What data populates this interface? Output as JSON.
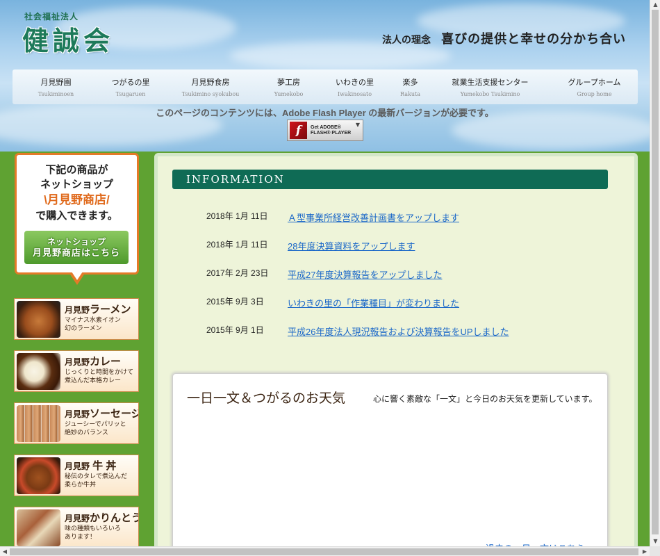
{
  "header": {
    "org_type": "社会福祉法人",
    "logo": "健誠会",
    "philosophy_label": "法人の理念",
    "philosophy_text": "喜びの提供と幸せの分かち合い"
  },
  "nav": {
    "items": [
      {
        "jp": "月見野園",
        "en": "Tsukiminoen"
      },
      {
        "jp": "つがるの里",
        "en": "Tsugaruen"
      },
      {
        "jp": "月見野食房",
        "en": "Tsukimino syokubou"
      },
      {
        "jp": "夢工房",
        "en": "Yumekobo"
      },
      {
        "jp": "いわきの里",
        "en": "Iwakinosato"
      },
      {
        "jp": "楽多",
        "en": "Rakuta"
      },
      {
        "jp": "就業生活支援センター",
        "en": "Yumekobo Tsukimino"
      },
      {
        "jp": "グループホーム",
        "en": "Group home"
      }
    ]
  },
  "flash": {
    "message": "このページのコンテンツには、Adobe Flash Player の最新バージョンが必要です。",
    "badge_line1": "Get ADOBE®",
    "badge_line2": "FLASH® PLAYER"
  },
  "sidebar": {
    "promo_line1": "下記の商品が",
    "promo_line2": "ネットショップ",
    "promo_shop": "\\月見野商店/",
    "promo_line3": "で購入できます。",
    "promo_button_line1": "ネットショップ",
    "promo_button_line2": "月見野商店はこちら",
    "products": [
      {
        "pre": "月見野",
        "main": "ラーメン",
        "desc": "マイナス水素イオン\n幻のラーメン"
      },
      {
        "pre": "月見野",
        "main": "カレー",
        "desc": "じっくりと時間をかけて\n煮込んだ本格カレー"
      },
      {
        "pre": "月見野",
        "main": "ソーセージ",
        "desc": "ジューシーでパリッと\n絶妙のバランス"
      },
      {
        "pre": "月見野",
        "main": " 牛 丼",
        "desc": "秘伝のタレで煮込んだ\n柔らか牛丼"
      },
      {
        "pre": "月見野",
        "main": "かりんとう",
        "desc": "味の種類もいろいろ\nあります！"
      }
    ]
  },
  "main": {
    "info_title": "INFORMATION",
    "news": [
      {
        "date": "2018年 1月 11日",
        "title": "Ａ型事業所経営改善計画書をアップします"
      },
      {
        "date": "2018年 1月 11日",
        "title": "28年度決算資料をアップします"
      },
      {
        "date": "2017年 2月 23日",
        "title": "平成27年度決算報告をアップしました"
      },
      {
        "date": "2015年 9月 3日",
        "title": "いわきの里の「作業種目」が変わりました"
      },
      {
        "date": "2015年 9月 1日",
        "title": "平成26年度法人現況報告および決算報告をUPしました"
      }
    ],
    "weather_title": "一日一文＆つがるのお天気",
    "weather_desc": "心に響く素敵な「一文」と今日のお天気を更新しています。",
    "weather_link": "過去の一日一文はこちら"
  },
  "colors": {
    "sidebar_green": "#5fa232",
    "info_bar": "#0f6b55",
    "promo_orange": "#e47a28",
    "link_blue": "#1a67c8"
  }
}
